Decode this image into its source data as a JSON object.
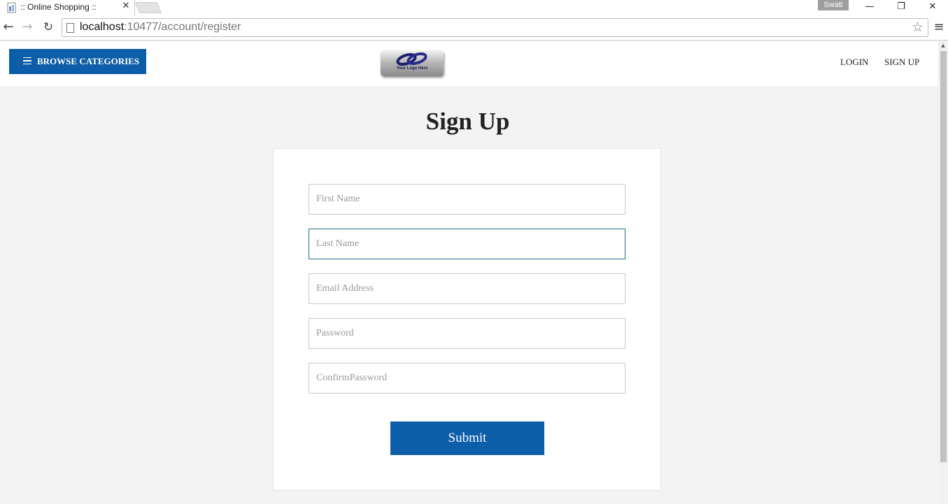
{
  "browser": {
    "tab_title": ":: Online Shopping ::",
    "tab_close": "✕",
    "profile_name": "Swati",
    "url_host": "localhost",
    "url_rest": ":10477/account/register",
    "back": "←",
    "forward": "→",
    "reload": "↻",
    "star": "☆",
    "menu": "≡",
    "minimize": "—",
    "maximize": "❐",
    "close": "✕"
  },
  "header": {
    "browse_label": "BROWSE CATEGORIES",
    "logo_text": "Your Logo Here",
    "nav": {
      "login": "LOGIN",
      "signup": "SIGN UP"
    }
  },
  "page": {
    "title": "Sign Up"
  },
  "form": {
    "first_name_placeholder": "First Name",
    "last_name_placeholder": "Last Name",
    "email_placeholder": "Email Address",
    "password_placeholder": "Password",
    "confirm_password_placeholder": "ConfirmPassword",
    "submit_label": "Submit"
  },
  "colors": {
    "accent": "#0d5ea8",
    "background": "#f3f3f3",
    "focus_border": "#1f6f8b"
  }
}
